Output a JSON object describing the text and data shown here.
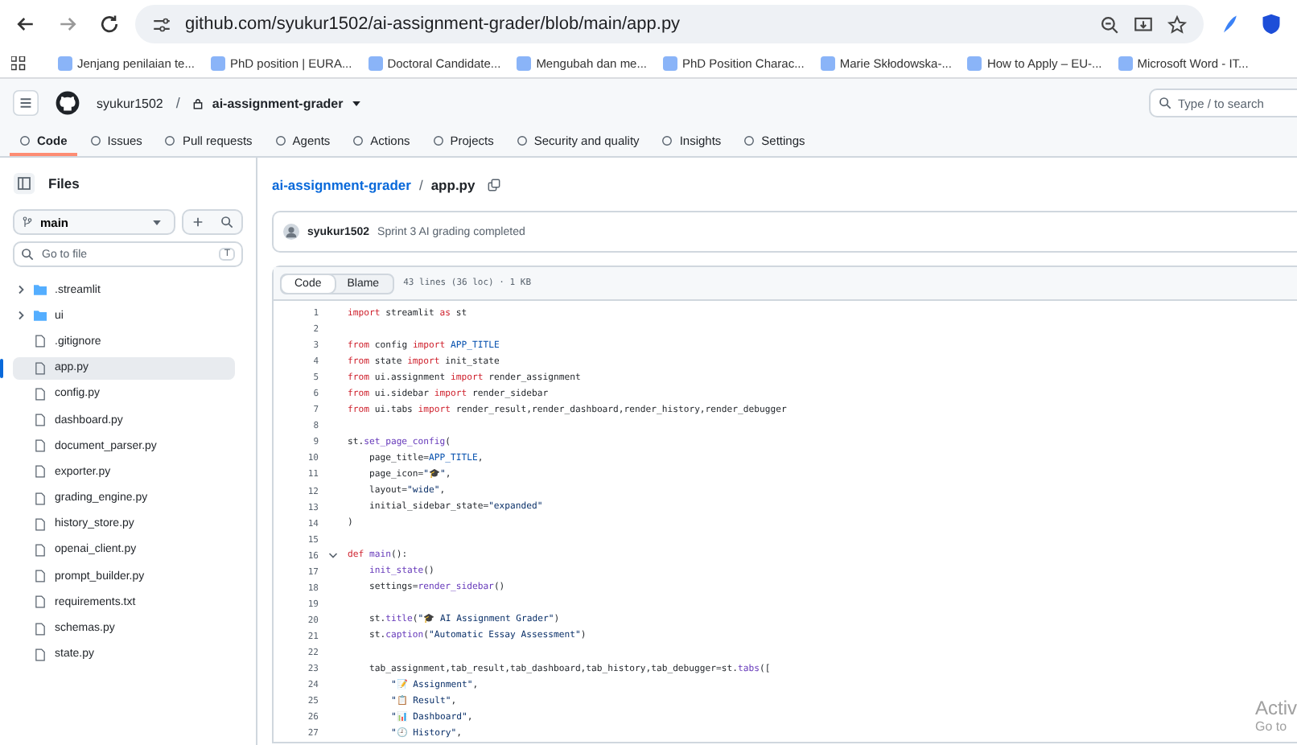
{
  "browser": {
    "url": "github.com/syukur1502/ai-assignment-grader/blob/main/app.py"
  },
  "bookmarks": [
    {
      "label": "Jenjang penilaian te..."
    },
    {
      "label": "PhD position | EURA..."
    },
    {
      "label": "Doctoral Candidate..."
    },
    {
      "label": "Mengubah dan me..."
    },
    {
      "label": "PhD Position Charac..."
    },
    {
      "label": "Marie Skłodowska-..."
    },
    {
      "label": "How to Apply – EU-..."
    },
    {
      "label": "Microsoft Word - IT..."
    }
  ],
  "header": {
    "owner": "syukur1502",
    "separator": "/",
    "repo": "ai-assignment-grader",
    "search_placeholder": "Type / to search"
  },
  "tabs": [
    {
      "label": "Code",
      "selected": true
    },
    {
      "label": "Issues",
      "selected": false
    },
    {
      "label": "Pull requests",
      "selected": false
    },
    {
      "label": "Agents",
      "selected": false
    },
    {
      "label": "Actions",
      "selected": false
    },
    {
      "label": "Projects",
      "selected": false
    },
    {
      "label": "Security and quality",
      "selected": false
    },
    {
      "label": "Insights",
      "selected": false
    },
    {
      "label": "Settings",
      "selected": false
    }
  ],
  "sidebar": {
    "title": "Files",
    "branch": "main",
    "filter_placeholder": "Go to file",
    "filter_key": "T",
    "items": [
      {
        "kind": "folder",
        "label": ".streamlit",
        "expanded": false,
        "selected": false
      },
      {
        "kind": "folder",
        "label": "ui",
        "expanded": false,
        "selected": false
      },
      {
        "kind": "file",
        "label": ".gitignore",
        "selected": false
      },
      {
        "kind": "file",
        "label": "app.py",
        "selected": true
      },
      {
        "kind": "file",
        "label": "config.py",
        "selected": false
      },
      {
        "kind": "file",
        "label": "dashboard.py",
        "selected": false
      },
      {
        "kind": "file",
        "label": "document_parser.py",
        "selected": false
      },
      {
        "kind": "file",
        "label": "exporter.py",
        "selected": false
      },
      {
        "kind": "file",
        "label": "grading_engine.py",
        "selected": false
      },
      {
        "kind": "file",
        "label": "history_store.py",
        "selected": false
      },
      {
        "kind": "file",
        "label": "openai_client.py",
        "selected": false
      },
      {
        "kind": "file",
        "label": "prompt_builder.py",
        "selected": false
      },
      {
        "kind": "file",
        "label": "requirements.txt",
        "selected": false
      },
      {
        "kind": "file",
        "label": "schemas.py",
        "selected": false
      },
      {
        "kind": "file",
        "label": "state.py",
        "selected": false
      }
    ]
  },
  "breadcrumb": {
    "repo": "ai-assignment-grader",
    "separator": "/",
    "file": "app.py"
  },
  "commit": {
    "author": "syukur1502",
    "message": "Sprint 3 AI grading completed"
  },
  "viewer": {
    "modes": [
      {
        "label": "Code",
        "selected": true
      },
      {
        "label": "Blame",
        "selected": false
      }
    ],
    "summary": "43 lines (36 loc) · 1 KB"
  },
  "code": [
    {
      "num": "1",
      "tokens": [
        {
          "kind": "keyword",
          "text": "import"
        },
        {
          "kind": "plain",
          "text": " streamlit "
        },
        {
          "kind": "keyword",
          "text": "as"
        },
        {
          "kind": "plain",
          "text": " st"
        }
      ]
    },
    {
      "num": "2"
    },
    {
      "num": "3",
      "tokens": [
        {
          "kind": "keyword",
          "text": "from"
        },
        {
          "kind": "plain",
          "text": " config "
        },
        {
          "kind": "keyword",
          "text": "import"
        },
        {
          "kind": "constant",
          "text": " APP_TITLE"
        }
      ]
    },
    {
      "num": "4",
      "tokens": [
        {
          "kind": "keyword",
          "text": "from"
        },
        {
          "kind": "plain",
          "text": " state "
        },
        {
          "kind": "keyword",
          "text": "import"
        },
        {
          "kind": "plain",
          "text": " init_state"
        }
      ]
    },
    {
      "num": "5",
      "tokens": [
        {
          "kind": "keyword",
          "text": "from"
        },
        {
          "kind": "plain",
          "text": " ui.assignment "
        },
        {
          "kind": "keyword",
          "text": "import"
        },
        {
          "kind": "plain",
          "text": " render_assignment"
        }
      ]
    },
    {
      "num": "6",
      "tokens": [
        {
          "kind": "keyword",
          "text": "from"
        },
        {
          "kind": "plain",
          "text": " ui.sidebar "
        },
        {
          "kind": "keyword",
          "text": "import"
        },
        {
          "kind": "plain",
          "text": " render_sidebar"
        }
      ]
    },
    {
      "num": "7",
      "tokens": [
        {
          "kind": "keyword",
          "text": "from"
        },
        {
          "kind": "plain",
          "text": " ui.tabs "
        },
        {
          "kind": "keyword",
          "text": "import"
        },
        {
          "kind": "plain",
          "text": " render_result,render_dashboard,render_history,render_debugger"
        }
      ]
    },
    {
      "num": "8"
    },
    {
      "num": "9",
      "tokens": [
        {
          "kind": "plain",
          "text": "st."
        },
        {
          "kind": "function",
          "text": "set_page_config"
        },
        {
          "kind": "plain",
          "text": "("
        }
      ]
    },
    {
      "num": "10",
      "tokens": [
        {
          "kind": "plain",
          "text": "    page_title="
        },
        {
          "kind": "constant",
          "text": "APP_TITLE"
        },
        {
          "kind": "plain",
          "text": ","
        }
      ]
    },
    {
      "num": "11",
      "tokens": [
        {
          "kind": "plain",
          "text": "    page_icon="
        },
        {
          "kind": "string",
          "text": "\"🎓\""
        },
        {
          "kind": "plain",
          "text": ","
        }
      ]
    },
    {
      "num": "12",
      "tokens": [
        {
          "kind": "plain",
          "text": "    layout="
        },
        {
          "kind": "string",
          "text": "\"wide\""
        },
        {
          "kind": "plain",
          "text": ","
        }
      ]
    },
    {
      "num": "13",
      "tokens": [
        {
          "kind": "plain",
          "text": "    initial_sidebar_state="
        },
        {
          "kind": "string",
          "text": "\"expanded\""
        }
      ]
    },
    {
      "num": "14",
      "tokens": [
        {
          "kind": "plain",
          "text": ")"
        }
      ]
    },
    {
      "num": "15"
    },
    {
      "num": "16",
      "expanded": true,
      "tokens": [
        {
          "kind": "keyword",
          "text": "def"
        },
        {
          "kind": "function",
          "text": " main"
        },
        {
          "kind": "plain",
          "text": "():"
        }
      ]
    },
    {
      "num": "17",
      "tokens": [
        {
          "kind": "function",
          "text": "    init_state"
        },
        {
          "kind": "plain",
          "text": "()"
        }
      ]
    },
    {
      "num": "18",
      "tokens": [
        {
          "kind": "plain",
          "text": "    settings="
        },
        {
          "kind": "function",
          "text": "render_sidebar"
        },
        {
          "kind": "plain",
          "text": "()"
        }
      ]
    },
    {
      "num": "19"
    },
    {
      "num": "20",
      "tokens": [
        {
          "kind": "plain",
          "text": "    st."
        },
        {
          "kind": "function",
          "text": "title"
        },
        {
          "kind": "plain",
          "text": "("
        },
        {
          "kind": "string",
          "text": "\"🎓 AI Assignment Grader\""
        },
        {
          "kind": "plain",
          "text": ")"
        }
      ]
    },
    {
      "num": "21",
      "tokens": [
        {
          "kind": "plain",
          "text": "    st."
        },
        {
          "kind": "function",
          "text": "caption"
        },
        {
          "kind": "plain",
          "text": "("
        },
        {
          "kind": "string",
          "text": "\"Automatic Essay Assessment\""
        },
        {
          "kind": "plain",
          "text": ")"
        }
      ]
    },
    {
      "num": "22"
    },
    {
      "num": "23",
      "tokens": [
        {
          "kind": "plain",
          "text": "    tab_assignment,tab_result,tab_dashboard,tab_history,tab_debugger=st."
        },
        {
          "kind": "function",
          "text": "tabs"
        },
        {
          "kind": "plain",
          "text": "(["
        }
      ]
    },
    {
      "num": "24",
      "tokens": [
        {
          "kind": "string",
          "text": "        \"📝 Assignment\""
        },
        {
          "kind": "plain",
          "text": ","
        }
      ]
    },
    {
      "num": "25",
      "tokens": [
        {
          "kind": "string",
          "text": "        \"📋 Result\""
        },
        {
          "kind": "plain",
          "text": ","
        }
      ]
    },
    {
      "num": "26",
      "tokens": [
        {
          "kind": "string",
          "text": "        \"📊 Dashboard\""
        },
        {
          "kind": "plain",
          "text": ","
        }
      ]
    },
    {
      "num": "27",
      "tokens": [
        {
          "kind": "string",
          "text": "        \"🕘 History\""
        },
        {
          "kind": "plain",
          "text": ","
        }
      ]
    }
  ],
  "os_overlay": {
    "line_1": "Activ",
    "line_2": "Go to"
  }
}
